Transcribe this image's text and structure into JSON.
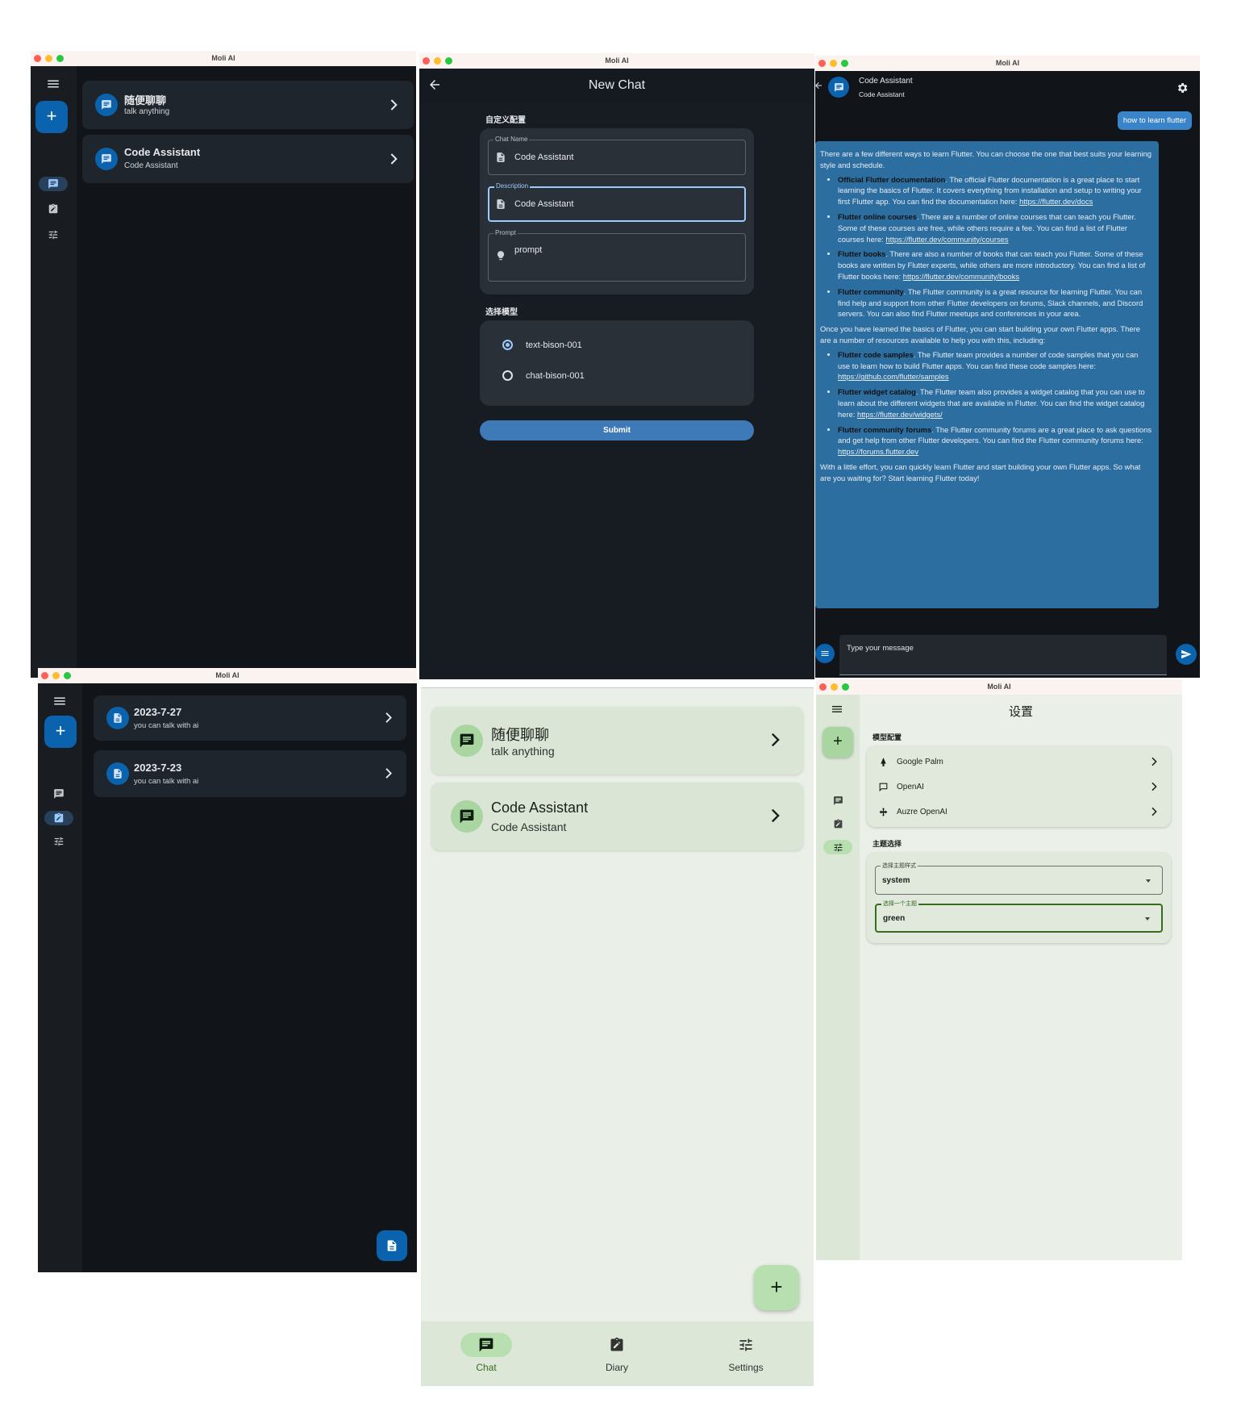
{
  "app_title": "Moli AI",
  "w1": {
    "items": [
      {
        "title": "随便聊聊",
        "subtitle": "talk anything"
      },
      {
        "title": "Code Assistant",
        "subtitle": "Code Assistant"
      }
    ]
  },
  "w2": {
    "header": "New Chat",
    "section1": "自定义配置",
    "chat_name_label": "Chat Name",
    "chat_name_value": "Code Assistant",
    "description_label": "Description",
    "description_value": "Code Assistant",
    "prompt_label": "Prompt",
    "prompt_value": "prompt",
    "section2": "选择模型",
    "models": [
      "text-bison-001",
      "chat-bison-001"
    ],
    "selected_model": "text-bison-001",
    "submit": "Submit"
  },
  "w3": {
    "title": "Code Assistant",
    "subtitle": "Code Assistant",
    "user_msg": "how to learn flutter",
    "intro": "There are a few different ways to learn Flutter. You can choose the one that best suits your learning style and schedule.",
    "list1": [
      {
        "bold": "Official Flutter documentation",
        "text": ". The official Flutter documentation is a great place to start learning the basics of Flutter. It covers everything from installation and setup to writing your first Flutter app. You can find the documentation here: ",
        "link": "https://flutter.dev/docs"
      },
      {
        "bold": "Flutter online courses",
        "text": ". There are a number of online courses that can teach you Flutter. Some of these courses are free, while others require a fee. You can find a list of Flutter courses here: ",
        "link": "https://flutter.dev/community/courses"
      },
      {
        "bold": "Flutter books",
        "text": ". There are also a number of books that can teach you Flutter. Some of these books are written by Flutter experts, while others are more introductory. You can find a list of Flutter books here: ",
        "link": "https://flutter.dev/community/books"
      },
      {
        "bold": "Flutter community",
        "text": ". The Flutter community is a great resource for learning Flutter. You can find help and support from other Flutter developers on forums, Slack channels, and Discord servers. You can also find Flutter meetups and conferences in your area.",
        "link": ""
      }
    ],
    "middle": "Once you have learned the basics of Flutter, you can start building your own Flutter apps. There are a number of resources available to help you with this, including:",
    "list2": [
      {
        "bold": "Flutter code samples",
        "text": ". The Flutter team provides a number of code samples that you can use to learn how to build Flutter apps. You can find these code samples here: ",
        "link": "https://github.com/flutter/samples"
      },
      {
        "bold": "Flutter widget catalog",
        "text": ". The Flutter team also provides a widget catalog that you can use to learn about the different widgets that are available in Flutter. You can find the widget catalog here: ",
        "link": "https://flutter.dev/widgets/"
      },
      {
        "bold": "Flutter community forums",
        "text": ". The Flutter community forums are a great place to ask questions and get help from other Flutter developers. You can find the Flutter community forums here: ",
        "link": "https://forums.flutter.dev"
      }
    ],
    "outro": "With a little effort, you can quickly learn Flutter and start building your own Flutter apps. So what are you waiting for? Start learning Flutter today!",
    "input_placeholder": "Type your message"
  },
  "w4": {
    "items": [
      {
        "title": "2023-7-27",
        "subtitle": "you can talk with ai"
      },
      {
        "title": "2023-7-23",
        "subtitle": "you can talk with ai"
      }
    ]
  },
  "w5": {
    "items": [
      {
        "title": "随便聊聊",
        "subtitle": "talk anything"
      },
      {
        "title": "Code Assistant",
        "subtitle": "Code Assistant"
      }
    ],
    "nav": [
      "Chat",
      "Diary",
      "Settings"
    ]
  },
  "w6": {
    "header": "设置",
    "section1": "模型配置",
    "providers": [
      "Google Palm",
      "OpenAI",
      "Auzre OpenAI"
    ],
    "section2": "主题选择",
    "theme_mode_label": "选择主题样式",
    "theme_mode_value": "system",
    "theme_label": "选择一个主题",
    "theme_value": "green"
  },
  "colors": {
    "dark_bg": "#111418",
    "accent_blue": "#0a63ac",
    "light_bg": "#eaf0e8",
    "accent_green": "#386a20"
  }
}
